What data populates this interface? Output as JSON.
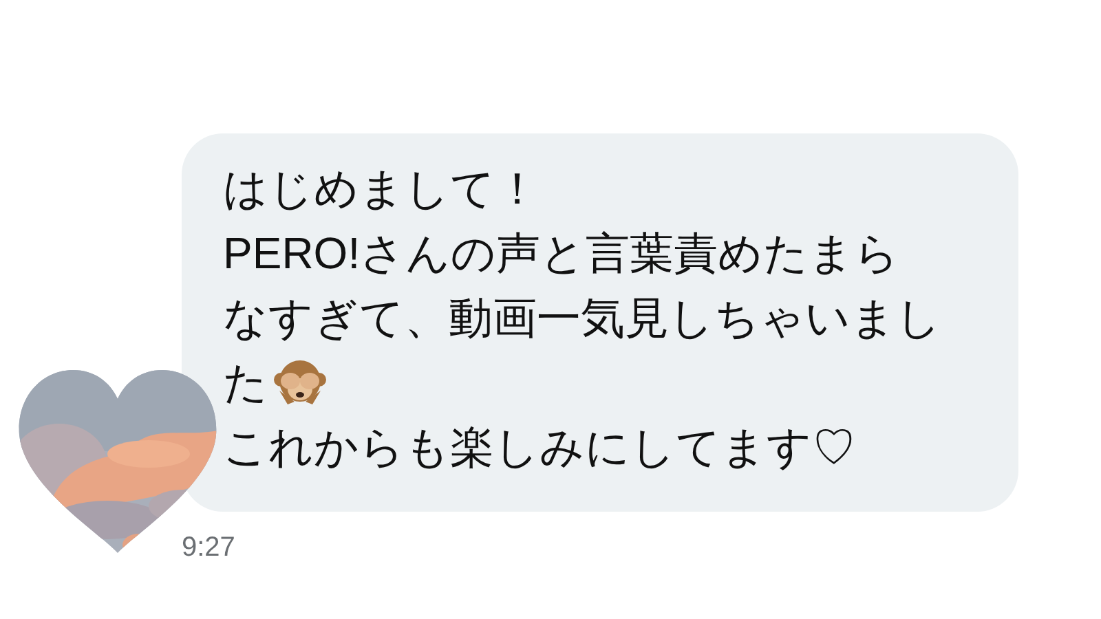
{
  "message": {
    "lines": [
      "はじめまして！",
      "PERO!さんの声と言葉責めたまら",
      "なすぎて、動画一気見しちゃいまし",
      "た",
      "これからも楽しみにしてます♡"
    ],
    "time": "9:27"
  }
}
